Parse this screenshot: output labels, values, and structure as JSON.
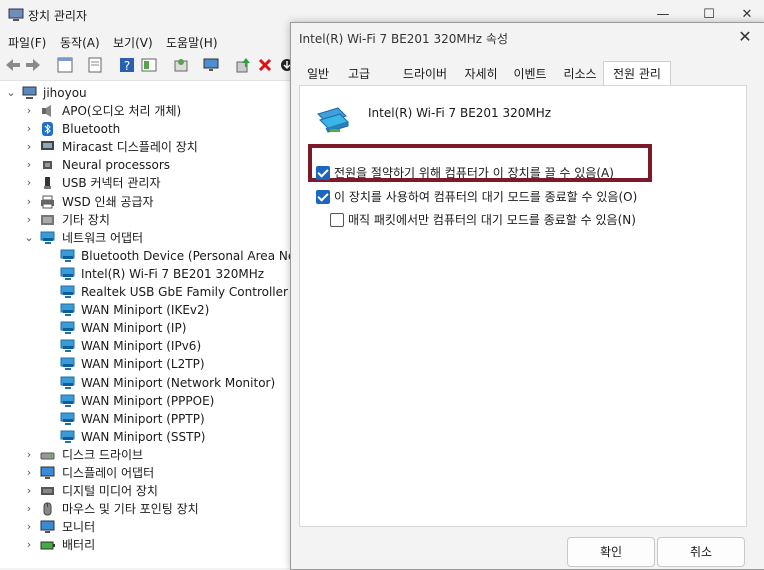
{
  "window": {
    "title": "장치 관리자"
  },
  "menu": [
    "파일(F)",
    "동작(A)",
    "보기(V)",
    "도움말(H)"
  ],
  "tree": {
    "root": "jihoyou",
    "items": [
      {
        "label": "APO(오디오 처리 개체)",
        "icon": "speaker-icon",
        "expanded": false
      },
      {
        "label": "Bluetooth",
        "icon": "bluetooth-icon",
        "expanded": false
      },
      {
        "label": "Miracast 디스플레이 장치",
        "icon": "display-icon",
        "expanded": false
      },
      {
        "label": "Neural processors",
        "icon": "chip-icon",
        "expanded": false
      },
      {
        "label": "USB 커넥터 관리자",
        "icon": "usb-icon",
        "expanded": false
      },
      {
        "label": "WSD 인쇄 공급자",
        "icon": "printer-icon",
        "expanded": false
      },
      {
        "label": "기타 장치",
        "icon": "unknown-device-icon",
        "expanded": false
      },
      {
        "label": "네트워크 어댑터",
        "icon": "network-icon",
        "expanded": true
      },
      {
        "label": "디스크 드라이브",
        "icon": "disk-icon",
        "expanded": false
      },
      {
        "label": "디스플레이 어댑터",
        "icon": "monitor-icon",
        "expanded": false
      },
      {
        "label": "디지털 미디어 장치",
        "icon": "media-icon",
        "expanded": false
      },
      {
        "label": "마우스 및 기타 포인팅 장치",
        "icon": "mouse-icon",
        "expanded": false
      },
      {
        "label": "모니터",
        "icon": "monitor-icon",
        "expanded": false
      },
      {
        "label": "배터리",
        "icon": "battery-icon",
        "expanded": false
      }
    ],
    "network_children": [
      "Bluetooth Device (Personal Area Netwo",
      "Intel(R) Wi-Fi 7 BE201 320MHz",
      "Realtek USB GbE Family Controller",
      "WAN Miniport (IKEv2)",
      "WAN Miniport (IP)",
      "WAN Miniport (IPv6)",
      "WAN Miniport (L2TP)",
      "WAN Miniport (Network Monitor)",
      "WAN Miniport (PPPOE)",
      "WAN Miniport (PPTP)",
      "WAN Miniport (SSTP)"
    ]
  },
  "dialog": {
    "title": "Intel(R) Wi-Fi 7 BE201 320MHz 속성",
    "tabs": [
      "일반",
      "고급",
      "드라이버",
      "자세히",
      "이벤트",
      "리소스",
      "전원 관리"
    ],
    "active_tab": "전원 관리",
    "device_name": "Intel(R) Wi-Fi 7 BE201 320MHz",
    "options": [
      {
        "label": "전원을 절약하기 위해 컴퓨터가 이 장치를 끌 수 있음(A)",
        "checked": true
      },
      {
        "label": "이 장치를 사용하여 컴퓨터의 대기 모드를 종료할 수 있음(O)",
        "checked": true
      },
      {
        "label": "매직 패킷에서만 컴퓨터의 대기 모드를 종료할 수 있음(N)",
        "checked": false
      }
    ],
    "ok": "확인",
    "cancel": "취소",
    "highlight_color": "#7d1928"
  }
}
